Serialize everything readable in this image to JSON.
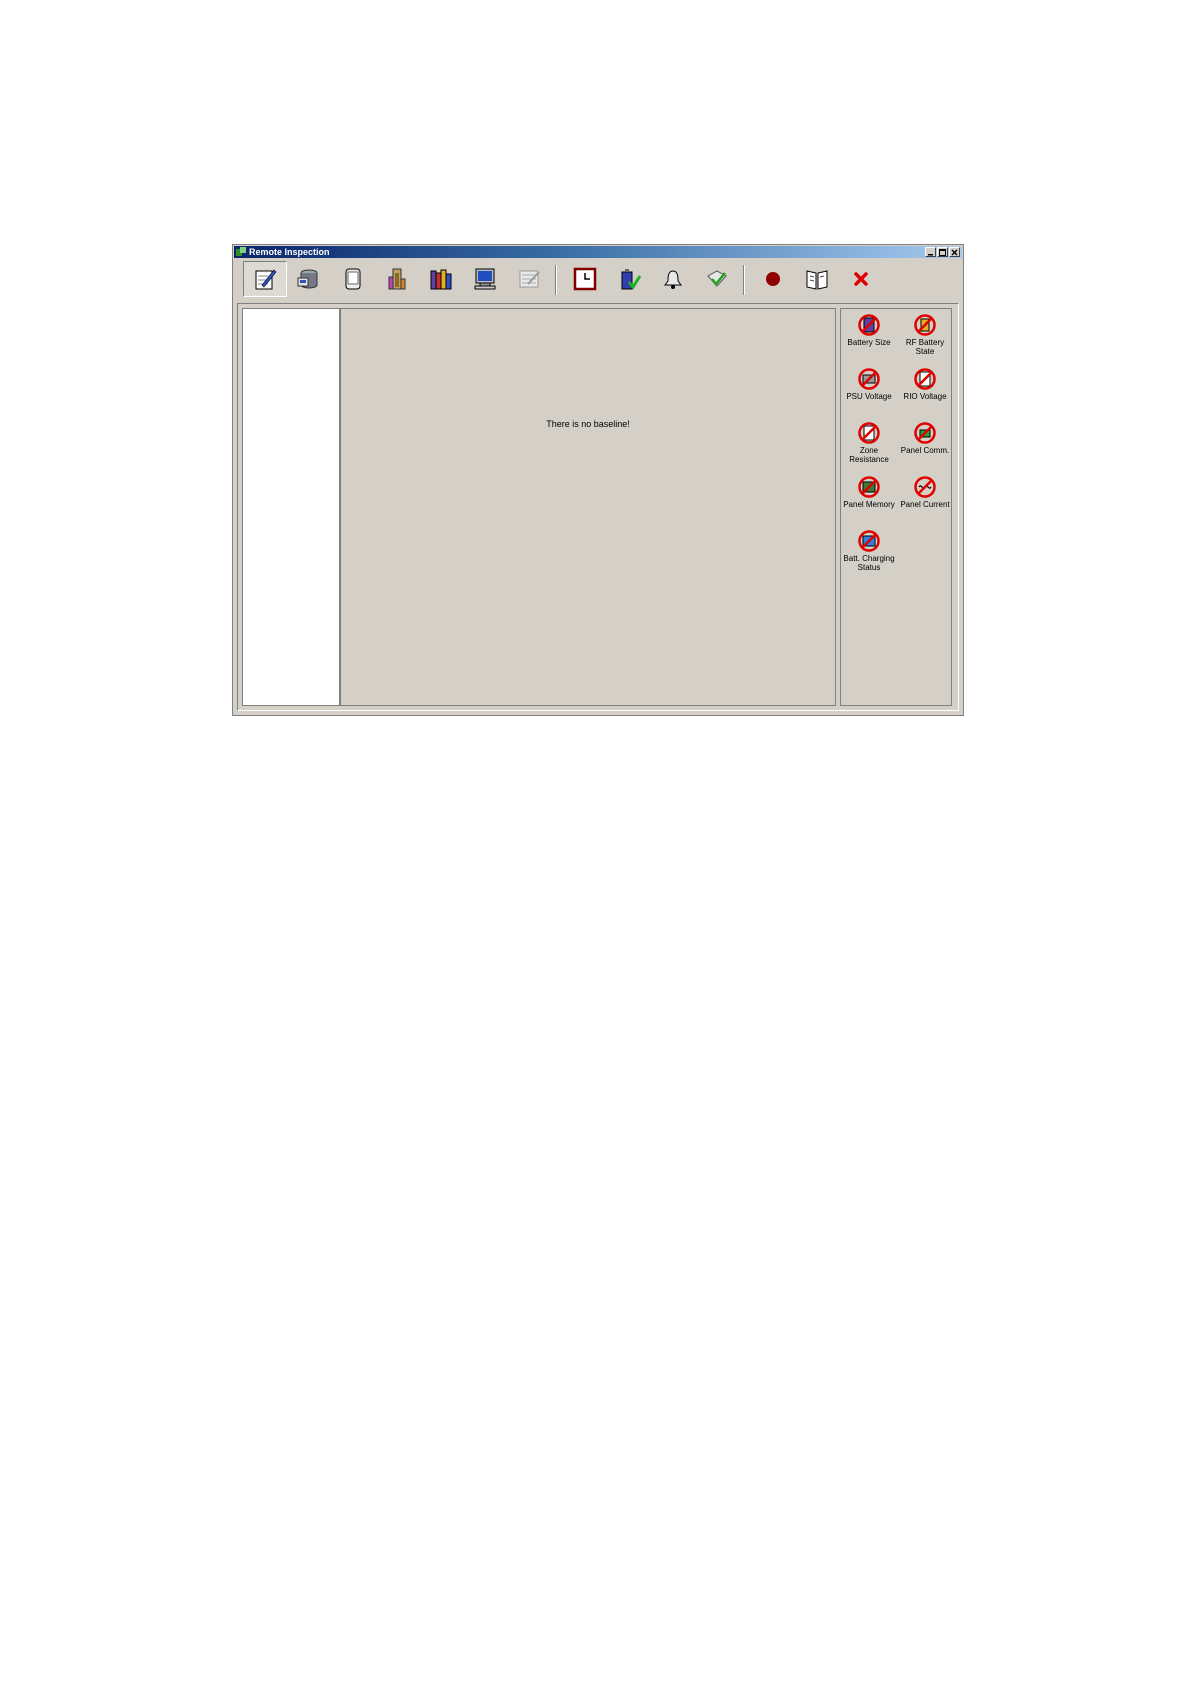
{
  "window": {
    "title": "Remote Inspection",
    "accent_color": "#0a246a"
  },
  "toolbar": {
    "buttons": [
      {
        "name": "notepad-pen-icon",
        "pressed": true
      },
      {
        "name": "database-icon"
      },
      {
        "name": "device-panel-icon"
      },
      {
        "name": "flask-tool-icon"
      },
      {
        "name": "books-icon"
      },
      {
        "name": "computer-icon"
      },
      {
        "name": "inspection-form-icon"
      },
      {
        "name": "clock-icon"
      },
      {
        "name": "battery-check-icon"
      },
      {
        "name": "bell-icon"
      },
      {
        "name": "signal-check-icon"
      },
      {
        "name": "stop-record-icon"
      },
      {
        "name": "book-open-icon"
      },
      {
        "name": "close-x-icon"
      }
    ]
  },
  "main": {
    "message": "There is no baseline!"
  },
  "checks": {
    "items": [
      {
        "label": "Battery Size",
        "icon": "battery-size-icon"
      },
      {
        "label": "RF Battery State",
        "icon": "rf-battery-state-icon"
      },
      {
        "label": "PSU Voltage",
        "icon": "psu-voltage-icon"
      },
      {
        "label": "RIO Voltage",
        "icon": "rio-voltage-icon"
      },
      {
        "label": "Zone Resistance",
        "icon": "zone-resistance-icon"
      },
      {
        "label": "Panel Comm.",
        "icon": "panel-comm-icon"
      },
      {
        "label": "Panel Memory",
        "icon": "panel-memory-icon"
      },
      {
        "label": "Panel Current",
        "icon": "panel-current-icon"
      },
      {
        "label": "Batt. Charging Status",
        "icon": "batt-charging-status-icon"
      }
    ],
    "forbid_color": "#e00000"
  }
}
